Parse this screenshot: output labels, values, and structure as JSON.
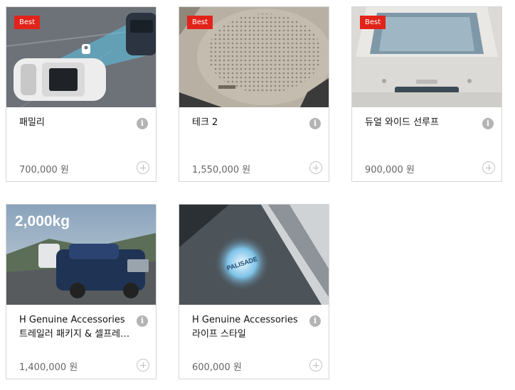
{
  "products": [
    {
      "badge": "Best",
      "title": "패밀리",
      "price": "700,000 원",
      "image": "parking-assist-sensor-image"
    },
    {
      "badge": "Best",
      "title": "테크 2",
      "price": "1,550,000 원",
      "image": "speaker-grille-image"
    },
    {
      "badge": "Best",
      "title": "듀얼 와이드 선루프",
      "price": "900,000 원",
      "image": "panoramic-sunroof-image"
    },
    {
      "badge": "",
      "title": "H Genuine Accessories 트레일러 패키지 & 셀프레벨라이저",
      "price": "1,400,000 원",
      "image": "suv-towing-trailer-image",
      "image_text": "2,000kg"
    },
    {
      "badge": "",
      "title": "H Genuine Accessories 라이프 스타일",
      "price": "600,000 원",
      "image": "puddle-lamp-sidestep-image",
      "image_text": "PALISADE"
    }
  ],
  "colors": {
    "badge": "#e2231a",
    "border": "#d6d6d6",
    "price": "#666666",
    "icon": "#b4b4b4"
  }
}
